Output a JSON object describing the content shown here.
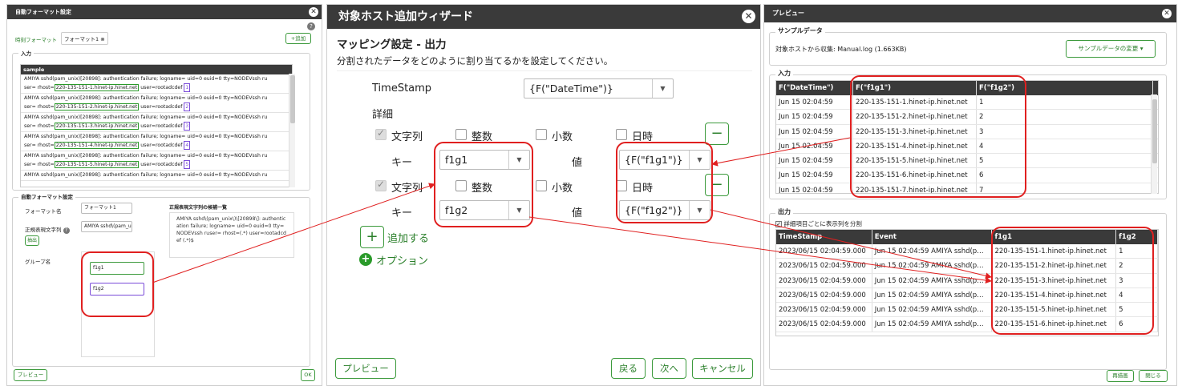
{
  "left": {
    "title": "自動フォーマット設定",
    "help_glyph": "?",
    "tab_time": "時刻フォーマット",
    "tab_fmt1": "フォーマット1",
    "add_label": "+追加",
    "input_legend": "入力",
    "sample_header": "sample",
    "sample_rows": [
      {
        "pre": "AMIYA sshd(pam_unix)[20898]: authentication failure; logname= uid=0 euid=0 tty=NODEVssh ru",
        "s2": "ser= rhost=",
        "host": "220-135-151-1.hinet-ip.hinet.net",
        "post": " user=rootadcdef ",
        "n": "1"
      },
      {
        "pre": "AMIYA sshd(pam_unix)[20898]: authentication failure; logname= uid=0 euid=0 tty=NODEVssh ru",
        "s2": "ser= rhost=",
        "host": "220-135-151-2.hinet-ip.hinet.net",
        "post": " user=rootadcdef ",
        "n": "2"
      },
      {
        "pre": "AMIYA sshd(pam_unix)[20898]: authentication failure; logname= uid=0 euid=0 tty=NODEVssh ru",
        "s2": "ser= rhost=",
        "host": "220-135-151-3.hinet-ip.hinet.net",
        "post": " user=rootadcdef ",
        "n": "3"
      },
      {
        "pre": "AMIYA sshd(pam_unix)[20898]: authentication failure; logname= uid=0 euid=0 tty=NODEVssh ru",
        "s2": "ser= rhost=",
        "host": "220-135-151-4.hinet-ip.hinet.net",
        "post": " user=rootadcdef ",
        "n": "4"
      },
      {
        "pre": "AMIYA sshd(pam_unix)[20898]: authentication failure; logname= uid=0 euid=0 tty=NODEVssh ru",
        "s2": "ser= rhost=",
        "host": "220-135-151-5.hinet-ip.hinet.net",
        "post": " user=rootadcdef ",
        "n": "5"
      },
      {
        "pre": "AMIYA sshd(pam_unix)[20898]: authentication failure; logname= uid=0 euid=0 tty=NODEVssh ru",
        "s2": "",
        "host": "",
        "post": "",
        "n": ""
      }
    ],
    "auto_legend": "自動フォーマット設定",
    "fmt_name_label": "フォーマット名",
    "fmt_name_value": "フォーマット1",
    "regex_label": "正規表現文字列",
    "regex_value": "AMIYA sshd\\(pam_u",
    "extract_label": "抽出",
    "group_label": "グループ名",
    "group1": "f1g1",
    "group2": "f1g2",
    "candidates_label": "正規表現文字列の候補一覧",
    "candidates_text": "AMIYA sshd\\(pam_unix\\)\\[20898\\]: authentication failure; logname= uid=0 euid=0 tty=NODEVssh ruser= rhost=(.*) user=rootadcdef (.*)$",
    "preview_label": "プレビュー",
    "ok_label": "OK"
  },
  "mid": {
    "title": "対象ホスト追加ウィザード",
    "section": "マッピング設定 - 出力",
    "desc": "分割されたデータをどのように割り当てるかを設定してください。",
    "timestamp_label": "TimeStamp",
    "timestamp_value": "{F(\"DateTime\")}",
    "detail_label": "詳細",
    "type_string": "文字列",
    "type_int": "整数",
    "type_decimal": "小数",
    "type_datetime": "日時",
    "key_label": "キー",
    "value_label": "値",
    "key1": "f1g1",
    "val1": "{F(\"f1g1\")}",
    "key2": "f1g2",
    "val2": "{F(\"f1g2\")}",
    "minus": "−",
    "plus": "+",
    "add_label": "追加する",
    "option_label": "オプション",
    "preview_btn": "プレビュー",
    "back_btn": "戻る",
    "next_btn": "次へ",
    "cancel_btn": "キャンセル"
  },
  "right": {
    "title": "プレビュー",
    "sample_legend": "サンプルデータ",
    "collected": "対象ホストから収集: Manual.log (1.663KB)",
    "change_btn": "サンプルデータの変更 ▾",
    "input_legend": "入力",
    "input_headers": [
      "F(\"DateTime\")",
      "F(\"f1g1\")",
      "F(\"f1g2\")"
    ],
    "input_rows": [
      [
        "Jun 15 02:04:59",
        "220-135-151-1.hinet-ip.hinet.net",
        "1"
      ],
      [
        "Jun 15 02:04:59",
        "220-135-151-2.hinet-ip.hinet.net",
        "2"
      ],
      [
        "Jun 15 02:04:59",
        "220-135-151-3.hinet-ip.hinet.net",
        "3"
      ],
      [
        "Jun 15 02:04:59",
        "220-135-151-4.hinet-ip.hinet.net",
        "4"
      ],
      [
        "Jun 15 02:04:59",
        "220-135-151-5.hinet-ip.hinet.net",
        "5"
      ],
      [
        "Jun 15 02:04:59",
        "220-135-151-6.hinet-ip.hinet.net",
        "6"
      ],
      [
        "Jun 15 02:04:59",
        "220-135-151-7.hinet-ip.hinet.net",
        "7"
      ]
    ],
    "output_legend": "出力",
    "split_label": "詳細項目ごとに表示列を分割",
    "output_headers": [
      "TimeStamp",
      "Event",
      "f1g1",
      "f1g2"
    ],
    "output_rows": [
      [
        "2023/06/15 02:04:59.000",
        "Jun 15 02:04:59 AMIYA sshd(p…",
        "220-135-151-1.hinet-ip.hinet.net",
        "1"
      ],
      [
        "2023/06/15 02:04:59.000",
        "Jun 15 02:04:59 AMIYA sshd(p…",
        "220-135-151-2.hinet-ip.hinet.net",
        "2"
      ],
      [
        "2023/06/15 02:04:59.000",
        "Jun 15 02:04:59 AMIYA sshd(p…",
        "220-135-151-3.hinet-ip.hinet.net",
        "3"
      ],
      [
        "2023/06/15 02:04:59.000",
        "Jun 15 02:04:59 AMIYA sshd(p…",
        "220-135-151-4.hinet-ip.hinet.net",
        "4"
      ],
      [
        "2023/06/15 02:04:59.000",
        "Jun 15 02:04:59 AMIYA sshd(p…",
        "220-135-151-5.hinet-ip.hinet.net",
        "5"
      ],
      [
        "2023/06/15 02:04:59.000",
        "Jun 15 02:04:59 AMIYA sshd(p…",
        "220-135-151-6.hinet-ip.hinet.net",
        "6"
      ]
    ],
    "redraw_btn": "再描画",
    "close_btn": "閉じる"
  },
  "colors": {
    "accent_green": "#3c9a3c",
    "annotation_red": "#e02020",
    "header_dark": "#3a3a3a",
    "group_purple": "#7a4bd8"
  }
}
